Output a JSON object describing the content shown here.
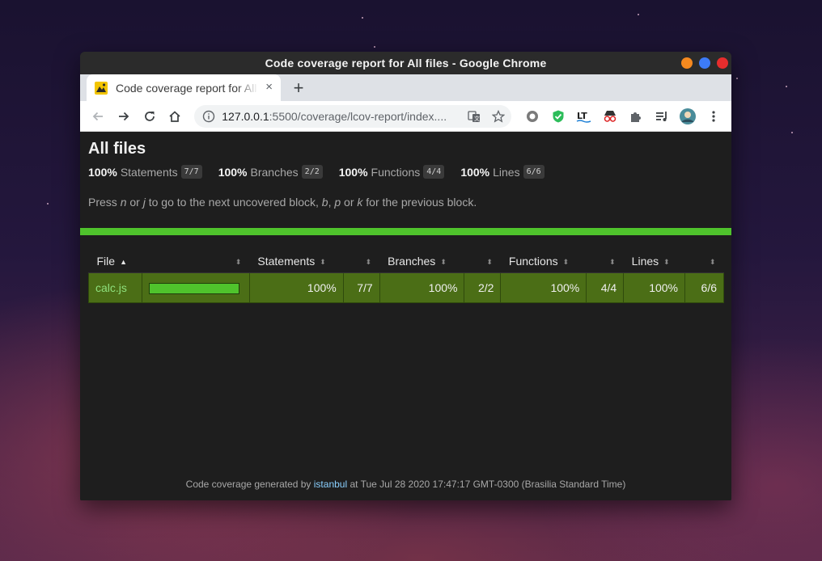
{
  "window": {
    "title": "Code coverage report for All files - Google Chrome"
  },
  "tab": {
    "title": "Code coverage report for All files",
    "new_tab": "+",
    "close": "×"
  },
  "address": {
    "host": "127.0.0.1",
    "path": ":5500/coverage/lcov-report/index...."
  },
  "report": {
    "heading": "All files",
    "summary": [
      {
        "pct": "100%",
        "label": "Statements",
        "fraction": "7/7"
      },
      {
        "pct": "100%",
        "label": "Branches",
        "fraction": "2/2"
      },
      {
        "pct": "100%",
        "label": "Functions",
        "fraction": "4/4"
      },
      {
        "pct": "100%",
        "label": "Lines",
        "fraction": "6/6"
      }
    ],
    "help": {
      "t1": "Press ",
      "k1": "n",
      "t2": " or ",
      "k2": "j",
      "t3": " to go to the next uncovered block, ",
      "k3": "b",
      "t4": ", ",
      "k4": "p",
      "t5": " or ",
      "k5": "k",
      "t6": " for the previous block."
    },
    "status_color": "#4fc32c",
    "table": {
      "headers": {
        "file": "File",
        "statements": "Statements",
        "branches": "Branches",
        "functions": "Functions",
        "lines": "Lines"
      },
      "rows": [
        {
          "file": "calc.js",
          "coverage_fraction": 1.0,
          "statements_pct": "100%",
          "statements_frac": "7/7",
          "branches_pct": "100%",
          "branches_frac": "2/2",
          "functions_pct": "100%",
          "functions_frac": "4/4",
          "lines_pct": "100%",
          "lines_frac": "6/6"
        }
      ]
    },
    "footer": {
      "prefix": "Code coverage generated by ",
      "link": "istanbul",
      "suffix": " at Tue Jul 28 2020 17:47:17 GMT-0300 (Brasilia Standard Time)"
    }
  }
}
